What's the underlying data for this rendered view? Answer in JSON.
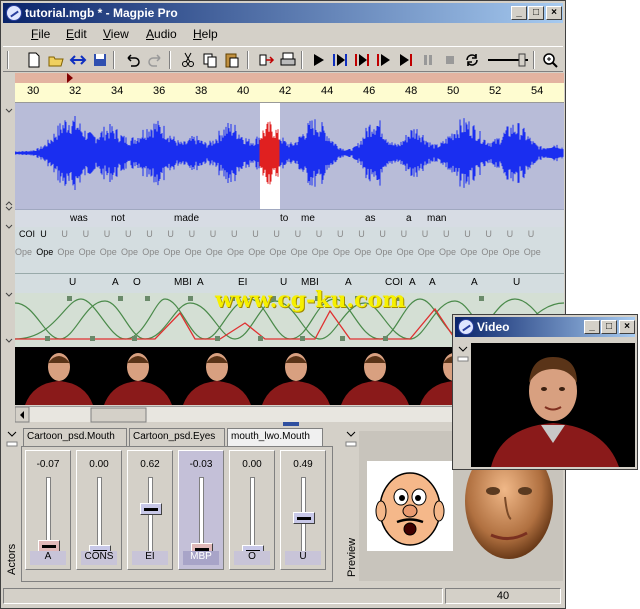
{
  "window": {
    "title": "tutorial.mgb * - Magpie Pro",
    "btn_min": "_",
    "btn_max": "□",
    "btn_close": "×"
  },
  "menu": [
    "File",
    "Edit",
    "View",
    "Audio",
    "Help"
  ],
  "menu_underline": [
    "F",
    "E",
    "V",
    "A",
    "H"
  ],
  "ruler": [
    "30",
    "32",
    "34",
    "36",
    "38",
    "40",
    "42",
    "44",
    "46",
    "48",
    "50",
    "52",
    "54"
  ],
  "words": [
    "was",
    "not",
    "made",
    "to",
    "me",
    "as",
    "a",
    "man"
  ],
  "phonemes_row1": [
    "COI",
    "U",
    "U",
    "U",
    "U",
    "U",
    "U",
    "U",
    "U",
    "U",
    "U",
    "U",
    "U",
    "U",
    "U",
    "U",
    "U",
    "U",
    "U",
    "U",
    "U",
    "U",
    "U",
    "U",
    "U"
  ],
  "phonemes_row2": [
    "Ope",
    "Ope",
    "Ope",
    "Ope",
    "Ope",
    "Ope",
    "Ope",
    "Ope",
    "Ope",
    "Ope",
    "Ope",
    "Ope",
    "Ope",
    "Ope",
    "Ope",
    "Ope",
    "Ope",
    "Ope",
    "Ope",
    "Ope",
    "Ope",
    "Ope",
    "Ope",
    "Ope",
    "Ope"
  ],
  "visemes": [
    "U",
    "A",
    "O",
    "MBI",
    "A",
    "EI",
    "U",
    "MBI",
    "A",
    "COI",
    "A",
    "A",
    "A",
    "U"
  ],
  "watermark": "www.cg-ku.com",
  "tabs": [
    "Cartoon_psd.Mouth",
    "Cartoon_psd.Eyes",
    "mouth_lwo.Mouth"
  ],
  "channels": [
    {
      "value": "-0.07",
      "label": "A",
      "level": 0.07
    },
    {
      "value": "0.00",
      "label": "CONS",
      "level": 0.0
    },
    {
      "value": "0.62",
      "label": "EI",
      "level": 0.62
    },
    {
      "value": "-0.03",
      "label": "MBP",
      "level": 0.03
    },
    {
      "value": "0.00",
      "label": "O",
      "level": 0.0
    },
    {
      "value": "0.49",
      "label": "U",
      "level": 0.49
    }
  ],
  "actors_label": "Actors",
  "preview_label": "Preview",
  "status": {
    "frame": "40"
  },
  "video_window": {
    "title": "Video",
    "btn_min": "_",
    "btn_max": "□",
    "btn_close": "×"
  }
}
